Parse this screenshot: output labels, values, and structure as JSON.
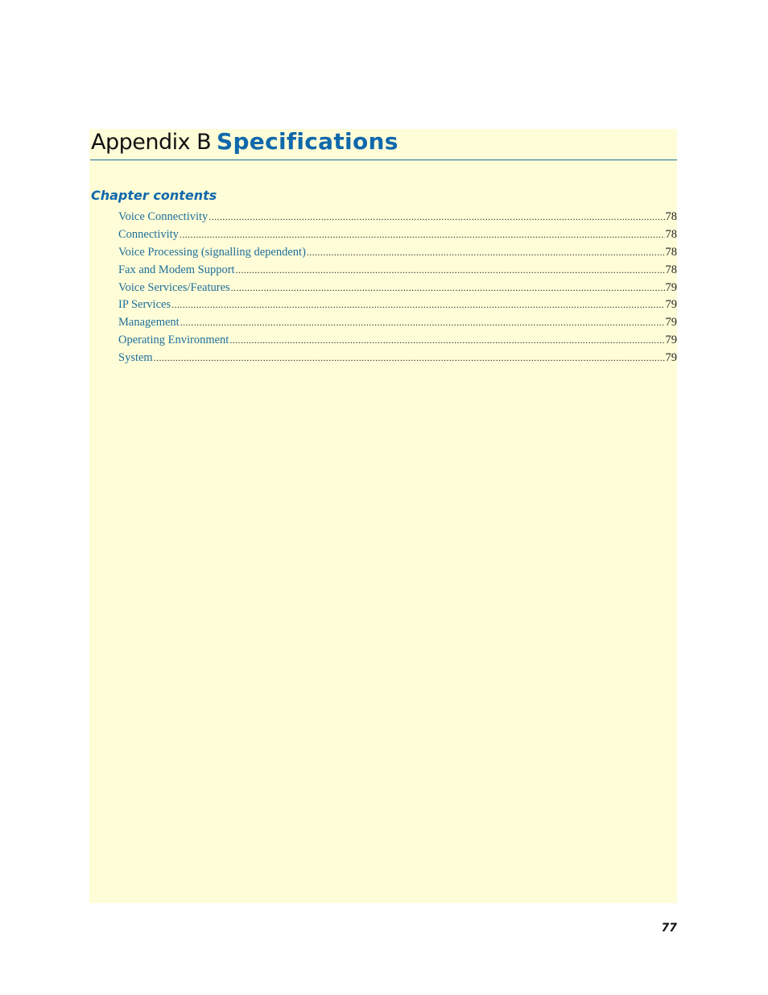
{
  "header": {
    "prefix": "Appendix B",
    "title": "Specifications"
  },
  "section": {
    "heading": "Chapter contents"
  },
  "toc": [
    {
      "title": "Voice Connectivity",
      "page": "78"
    },
    {
      "title": "Connectivity",
      "page": "78"
    },
    {
      "title": "Voice Processing (signalling dependent) ",
      "page": "78"
    },
    {
      "title": "Fax and Modem Support",
      "page": "78"
    },
    {
      "title": "Voice Services/Features",
      "page": "79"
    },
    {
      "title": "IP Services ",
      "page": "79"
    },
    {
      "title": "Management ",
      "page": "79"
    },
    {
      "title": "Operating Environment ",
      "page": "79"
    },
    {
      "title": "System",
      "page": "79"
    }
  ],
  "footer": {
    "page_number": "77"
  },
  "colors": {
    "panel_background": "#fefdd8",
    "accent_blue": "#1068ab",
    "link_blue": "#1f6e9a"
  }
}
